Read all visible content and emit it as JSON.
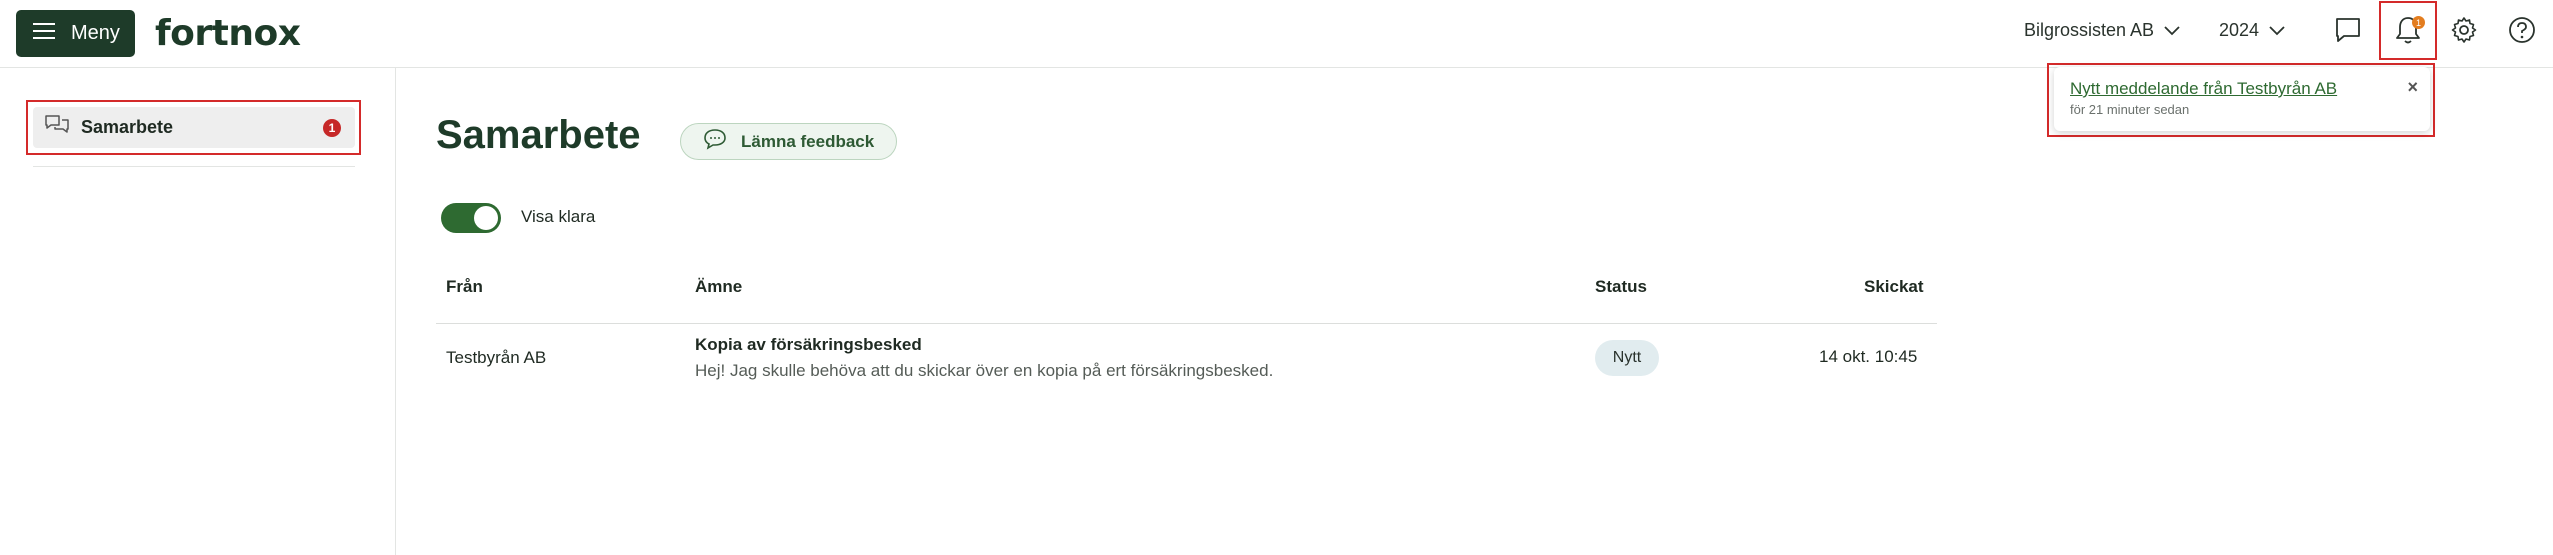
{
  "header": {
    "menu_label": "Meny",
    "logo_text": "fortnox",
    "company_selector": "Bilgrossisten AB",
    "year_selector": "2024",
    "notification_count": "1",
    "icons": [
      "menu-icon",
      "chat-icon",
      "bell-icon",
      "gear-icon",
      "help-icon"
    ]
  },
  "notification": {
    "message": "Nytt meddelande från Testbyrån AB",
    "time": "för 21 minuter sedan",
    "close": "×"
  },
  "sidebar": {
    "items": [
      {
        "label": "Samarbete",
        "badge": "1",
        "icon": "chat-bubbles-icon"
      }
    ]
  },
  "main": {
    "title": "Samarbete",
    "feedback_label": "Lämna feedback",
    "toggle_label": "Visa klara",
    "toggle_on": true,
    "table": {
      "headers": {
        "from": "Från",
        "subject": "Ämne",
        "status": "Status",
        "sent": "Skickat"
      },
      "rows": [
        {
          "from": "Testbyrån AB",
          "subject_title": "Kopia av försäkringsbesked",
          "subject_body": "Hej! Jag skulle behöva att du skickar över en kopia på ert försäkringsbesked.",
          "status": "Nytt",
          "sent": "14 okt. 10:45"
        }
      ]
    }
  },
  "colors": {
    "brand_dark": "#1e3b29",
    "accent_green": "#2e6a31",
    "highlight_red": "#d42a2a",
    "badge_red": "#c62828",
    "badge_orange": "#e37d1f"
  }
}
